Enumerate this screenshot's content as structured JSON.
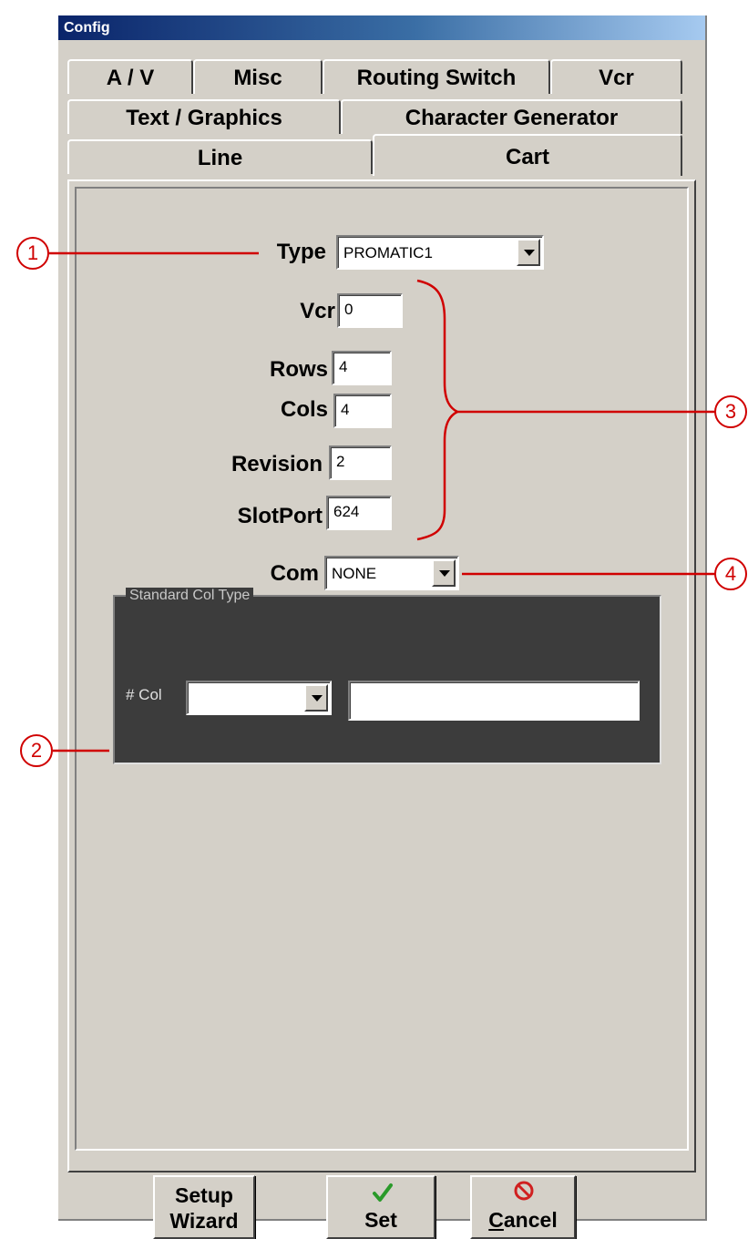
{
  "window": {
    "title": "Config"
  },
  "tabs": {
    "row1": [
      "A / V",
      "Misc",
      "Routing Switch",
      "Vcr"
    ],
    "row2": [
      "Text / Graphics",
      "Character Generator"
    ],
    "row3": [
      "Line",
      "Cart"
    ],
    "active": "Cart"
  },
  "cart": {
    "type_label": "Type",
    "type_value": "PROMATIC1",
    "vcr_label": "Vcr",
    "vcr_value": "0",
    "rows_label": "Rows",
    "rows_value": "4",
    "cols_label": "Cols",
    "cols_value": "4",
    "revision_label": "Revision",
    "revision_value": "2",
    "slotport_label": "SlotPort",
    "slotport_value": "624",
    "com_label": "Com",
    "com_value": "NONE"
  },
  "standard_col_type": {
    "title": "Standard Col Type",
    "col_label": "# Col",
    "col_value": "",
    "text_value": ""
  },
  "buttons": {
    "setup_wizard_line1": "Setup",
    "setup_wizard_line2": "Wizard",
    "set": "Set",
    "cancel_first": "C",
    "cancel_rest": "ancel"
  },
  "callouts": [
    "1",
    "2",
    "3",
    "4"
  ],
  "colors": {
    "callout": "#d00000",
    "titlebar": "#0a246a",
    "check": "#2a9a2a",
    "cancel_icon": "#d02020"
  },
  "icons": {
    "set": "checkmark-icon",
    "cancel": "no-entry-icon"
  }
}
